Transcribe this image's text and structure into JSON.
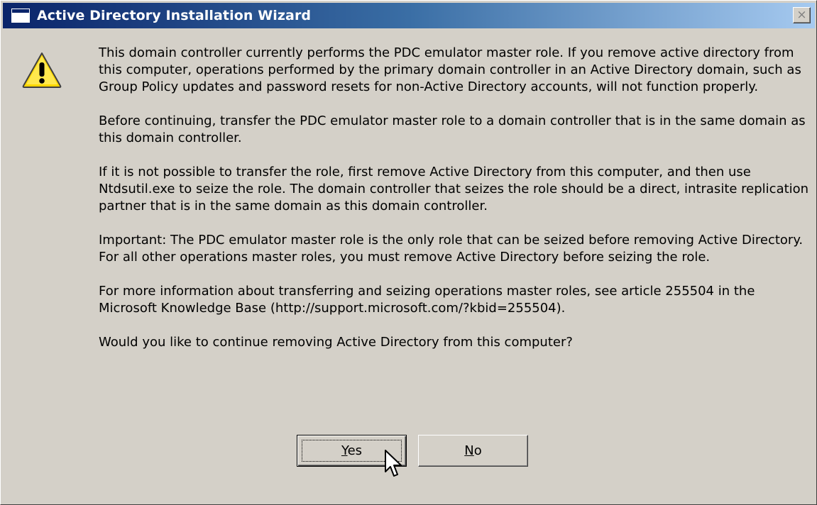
{
  "window": {
    "title": "Active Directory Installation Wizard",
    "close_glyph": "×"
  },
  "icons": {
    "dialog_icon": "warning-icon",
    "title_icon": "window-icon",
    "cursor": "arrow-cursor"
  },
  "message": {
    "paragraphs": [
      "This domain controller currently performs the PDC emulator master role. If you remove active directory from this computer, operations performed by the primary domain controller in an Active Directory domain, such as Group Policy updates and password resets for non-Active Directory accounts, will not function properly.",
      "Before continuing, transfer the PDC emulator master role to a domain controller that is in the same domain as this domain controller.",
      "If it is not possible to transfer the role, first remove Active Directory from this computer, and then use Ntdsutil.exe to seize the role. The domain controller that seizes the role should be a direct, intrasite replication partner that is in the same domain as this domain controller.",
      "Important: The PDC emulator master role is the only role that can be seized before removing Active Directory. For all other operations master roles, you must remove Active Directory before seizing the role.",
      "For more information about transferring and seizing operations master roles, see article 255504 in the Microsoft Knowledge Base (http://support.microsoft.com/?kbid=255504).",
      "Would you like to continue removing Active Directory from this computer?"
    ]
  },
  "buttons": {
    "yes": {
      "accel": "Y",
      "rest": "es"
    },
    "no": {
      "accel": "N",
      "rest": "o"
    }
  },
  "colors": {
    "dialog_bg": "#d4d0c8",
    "title_start": "#0a246a",
    "title_end": "#a6caf0",
    "warning_yellow": "#ffd700"
  }
}
